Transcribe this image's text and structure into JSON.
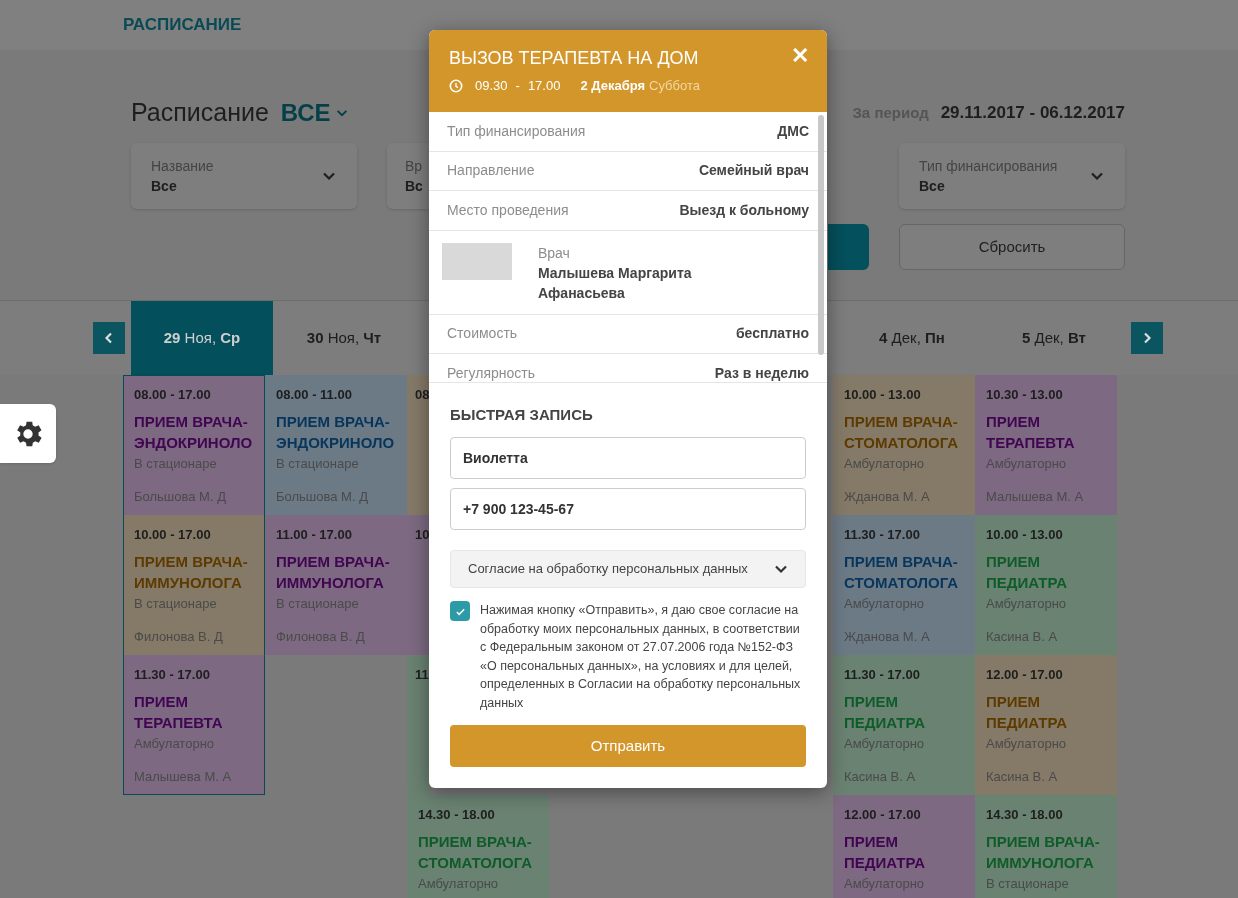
{
  "header": {
    "title": "РАСПИСАНИЕ"
  },
  "page_title": {
    "label": "Расписание",
    "filter": "ВСЕ"
  },
  "period": {
    "label": "За период",
    "value": "29.11.2017 - 06.12.2017"
  },
  "filters": [
    {
      "label": "Название",
      "value": "Все"
    },
    {
      "label": "Вр",
      "value": "Вс"
    },
    {
      "label": "Тип финансирования",
      "value": "Все"
    }
  ],
  "reset_button": {
    "label": "Сбросить"
  },
  "day_tabs": [
    {
      "label": "**29** Ноя, **Ср**",
      "selected": true
    },
    {
      "label": "**30** Ноя, **Чт**",
      "selected": false
    },
    {
      "label": "**4** Дек, **Пн**",
      "selected": false
    },
    {
      "label": "**5** Дек, **Вт**",
      "selected": false
    }
  ],
  "columns": [
    {
      "cards": [
        {
          "time": "08.00 - 17.00",
          "title": "ПРИЕМ ВРАЧА-ЭНДОКРИНОЛО",
          "place": "В стационаре",
          "doctor": "Большова М. Д",
          "color": "#7d6a82"
        },
        {
          "time": "10.00 - 17.00",
          "title": "ПРИЕМ ВРАЧА-ИММУНОЛОГА",
          "place": "В стационаре",
          "doctor": "Филонова В. Д",
          "color": "#857a68"
        },
        {
          "time": "11.30 - 17.00",
          "title": "ПРИЕМ ТЕРАПЕВТА",
          "place": "Амбулаторно",
          "doctor": "Малышева М. А",
          "color": "#7d6a82"
        }
      ]
    },
    {
      "cards": [
        {
          "time": "08.00 - 11.00",
          "title": "ПРИЕМ ВРАЧА-ЭНДОКРИНОЛО",
          "place": "В стационаре",
          "doctor": "Большова М. Д",
          "color": "#6c7a86"
        },
        {
          "time": "11.00 - 17.00",
          "title": "ПРИЕМ ВРАЧА-ИММУНОЛОГА",
          "place": "В стационаре",
          "doctor": "Филонова В. Д",
          "color": "#7d6a82"
        }
      ]
    },
    {
      "cards": [
        {
          "time": "08",
          "color": "#857a68"
        },
        {
          "time": "10",
          "color": "#7d6a82"
        },
        {
          "time": "11",
          "color": "#6a8272"
        },
        {
          "time": "14.30 - 18.00",
          "title": "ПРИЕМ ВРАЧА-СТОМАТОЛОГА",
          "place": "Амбулаторно",
          "color": "#6a8272"
        }
      ]
    },
    {
      "cards": [
        {
          "time": "10.00 - 13.00",
          "title": "ПРИЕМ ВРАЧА-СТОМАТОЛОГА",
          "place": "Амбулаторно",
          "doctor": "Жданова М. А",
          "color": "#857a68"
        },
        {
          "time": "11.30 - 17.00",
          "title": "ПРИЕМ ВРАЧА-СТОМАТОЛОГА",
          "place": "Амбулаторно",
          "doctor": "Жданова М. А",
          "color": "#6c7a86"
        },
        {
          "time": "11.30 - 17.00",
          "title": "ПРИЕМ ПЕДИАТРА",
          "place": "Амбулаторно",
          "doctor": "Касина В. А",
          "color": "#6a8272"
        },
        {
          "time": "12.00 - 17.00",
          "title": "ПРИЕМ ПЕДИАТРА",
          "place": "Амбулаторно",
          "color": "#7d6a82"
        }
      ]
    },
    {
      "cards": [
        {
          "time": "10.30 - 13.00",
          "title": "ПРИЕМ ТЕРАПЕВТА",
          "place": "Амбулаторно",
          "doctor": "Малышева М. А",
          "color": "#7d6a82"
        },
        {
          "time": "10.00 - 13.00",
          "title": "ПРИЕМ ПЕДИАТРА",
          "place": "Амбулаторно",
          "doctor": "Касина В. А",
          "color": "#6a8272"
        },
        {
          "time": "12.00 - 17.00",
          "title": "ПРИЕМ ПЕДИАТРА",
          "place": "Амбулаторно",
          "doctor": "Касина В. А",
          "color": "#857a68"
        },
        {
          "time": "14.30 - 18.00",
          "title": "ПРИЕМ ВРАЧА-ИММУНОЛОГА",
          "place": "В стационаре",
          "color": "#6a8272"
        }
      ]
    }
  ],
  "modal": {
    "title": "ВЫЗОВ ТЕРАПЕВТА НА ДОМ",
    "close": "✕",
    "time_from": "09.30",
    "time_sep": "-",
    "time_to": "17.00",
    "date": "2 Декабря",
    "weekday": "Суббота",
    "details": [
      {
        "kind": "field",
        "label": "Тип финансирования",
        "value": "ДМС"
      },
      {
        "kind": "field",
        "label": "Направление",
        "value": "Семейный врач"
      },
      {
        "kind": "field",
        "label": "Место проведения",
        "value": "Выезд к больному"
      },
      {
        "kind": "doctor",
        "label": "Врач",
        "value": "Малышева Маргарита Афанасьева"
      },
      {
        "kind": "field",
        "label": "Стоимость",
        "value": "бесплатно"
      },
      {
        "kind": "field",
        "label": "Регулярность",
        "value": "Раз в неделю"
      }
    ],
    "form_title": "БЫСТРАЯ ЗАПИСЬ",
    "name_field": {
      "value": "Виолетта"
    },
    "phone_field": {
      "value": "+7 900 123-45-67"
    },
    "consent_dropdown": {
      "label": "Согласие на обработку персональных данных"
    },
    "consent": {
      "checked": true,
      "text": "Нажимая кнопку «Отправить», я даю свое согласие на обработку моих персональных данных, в соответствии с Федеральным законом от 27.07.2006 года №152-ФЗ «О персональных данных», на условиях и для целей, определенных в Согласии на обработку персональных данных"
    },
    "submit": {
      "label": "Отправить"
    }
  }
}
